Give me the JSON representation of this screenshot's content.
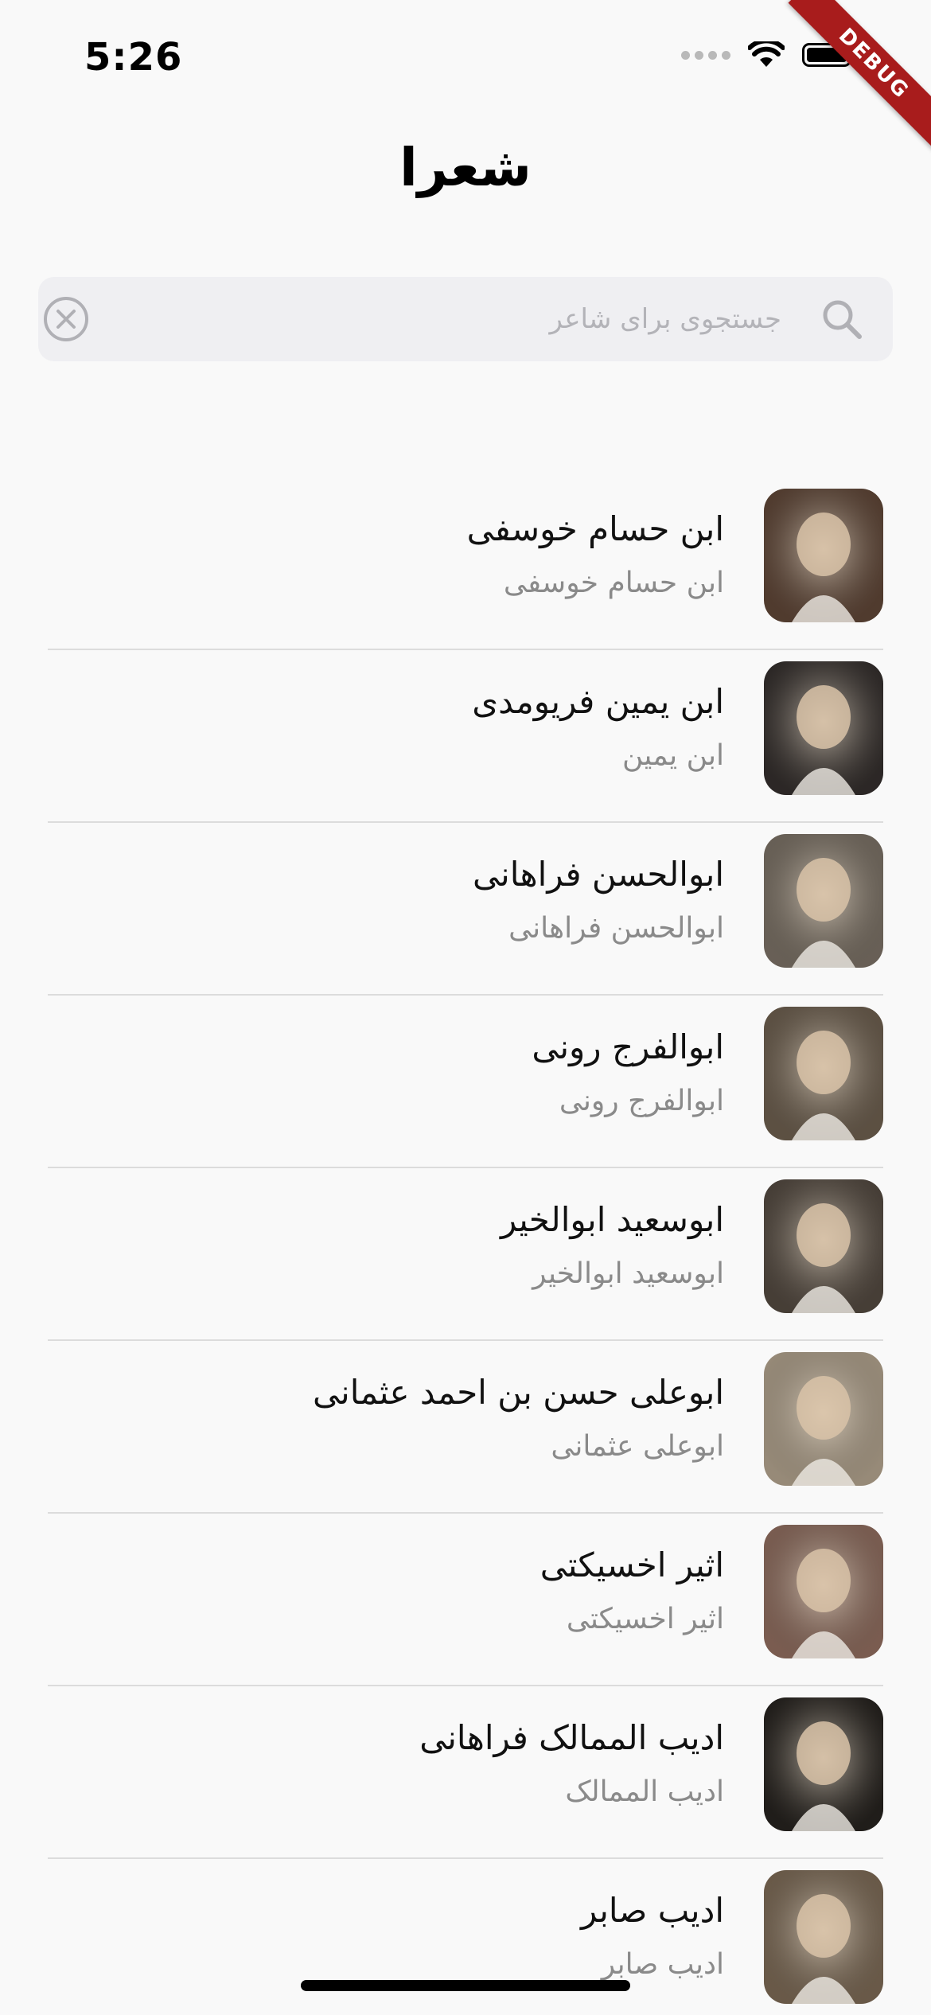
{
  "status_bar": {
    "time": "5:26"
  },
  "debug_banner": "DEBUG",
  "header": {
    "title": "شعرا"
  },
  "search": {
    "placeholder": "جستجوی برای شاعر"
  },
  "poets": [
    {
      "name": "ابن حسام خوسفی",
      "subtitle": "ابن حسام خوسفی",
      "tone": "#6b4e3d"
    },
    {
      "name": "ابن یمین فریومدی",
      "subtitle": "ابن یمین",
      "tone": "#3a3432"
    },
    {
      "name": "ابوالحسن فراهانی",
      "subtitle": "ابوالحسن فراهانی",
      "tone": "#8a7f72"
    },
    {
      "name": "ابوالفرج رونی",
      "subtitle": "ابوالفرج رونی",
      "tone": "#7a6a58"
    },
    {
      "name": "ابوسعید ابوالخیر",
      "subtitle": "ابوسعید ابوالخیر",
      "tone": "#5d5248"
    },
    {
      "name": "ابوعلی حسن بن احمد عثمانی",
      "subtitle": "ابوعلی عثمانی",
      "tone": "#c9b8a0"
    },
    {
      "name": "اثیر اخسیکتی",
      "subtitle": "اثیر اخسیکتی",
      "tone": "#a27a6a"
    },
    {
      "name": "ادیب الممالک فراهانی",
      "subtitle": "ادیب الممالک",
      "tone": "#2a2622"
    },
    {
      "name": "ادیب صابر",
      "subtitle": "ادیب صابر",
      "tone": "#8c7760"
    }
  ]
}
